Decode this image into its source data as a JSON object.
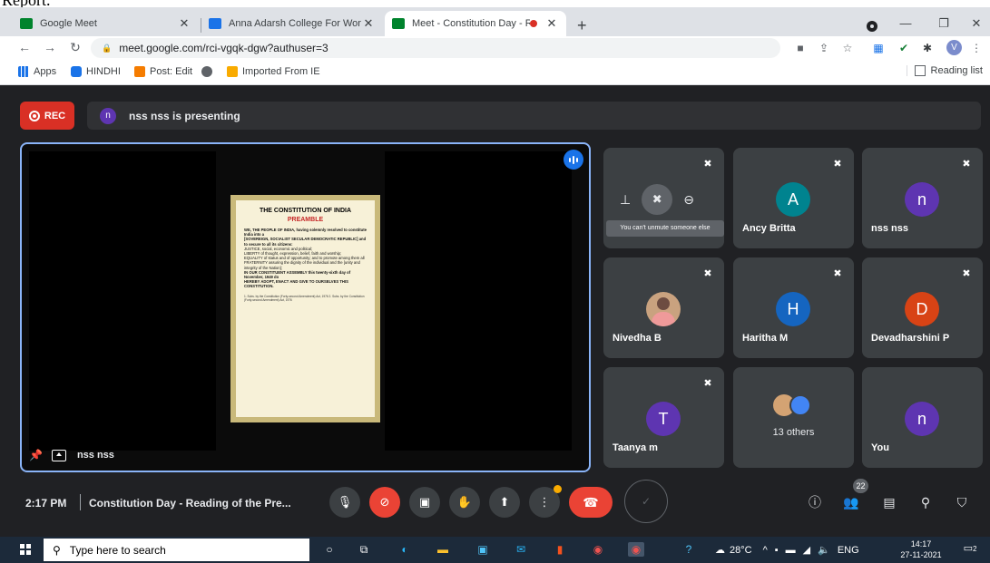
{
  "colors": {
    "accent": "#8ab4f8",
    "danger": "#ea4335",
    "tile_bg": "#3c4043",
    "meet_bg": "#202124"
  },
  "crop_text": "Report.",
  "browser": {
    "tabs": [
      {
        "label": "Google Meet",
        "icon": "google-meet-icon"
      },
      {
        "label": "Anna Adarsh College For Women",
        "icon": "calendar-icon"
      },
      {
        "label": "Meet - Constitution Day - Re",
        "icon": "google-meet-icon",
        "recording": true
      }
    ],
    "url": "meet.google.com/rci-vgqk-dgw?authuser=3",
    "profile_initial": "V",
    "bookmarks": [
      "Apps",
      "HINDHI",
      "Post: Edit",
      "Imported From IE"
    ],
    "reading_list": "Reading list"
  },
  "meet": {
    "rec_label": "REC",
    "presenting_initial": "n",
    "presenting_text": "nss nss is presenting",
    "presenter_tile_name": "nss nss",
    "document": {
      "title": "THE CONSTITUTION OF INDIA",
      "subtitle": "PREAMBLE",
      "lines": [
        "WE, THE PEOPLE OF INDIA, having solemnly resolved to constitute India into a",
        "[SOVEREIGN, SOCIALIST SECULAR DEMOCRATIC REPUBLIC] and to secure to all its citizens:",
        "JUSTICE, social, economic and political;",
        "LIBERTY of thought, expression, belief, faith and worship;",
        "EQUALITY of status and of opportunity; and to promote among them all",
        "FRATERNITY assuring the dignity of the individual and the [unity and integrity of the Nation];",
        "IN OUR CONSTITUENT ASSEMBLY this twenty-sixth day of November, 1949 do",
        "HEREBY ADOPT, ENACT AND GIVE TO OURSELVES THIS CONSTITUTION."
      ],
      "notes": "1. Subs. by the Constitution (Forty-second Amendment) Act, 1976 2. Subs. by the Constitution (Forty-second Amendment) Act, 1976"
    },
    "hover_tooltip": "You can't unmute someone else",
    "participants": [
      {
        "name": "Ancy Britta",
        "initial": "A",
        "color": "#00838f"
      },
      {
        "name": "nss nss",
        "initial": "n",
        "color": "#5e35b1"
      },
      {
        "name": "Nivedha B",
        "initial": "",
        "color": "#c9a27f"
      },
      {
        "name": "Haritha M",
        "initial": "H",
        "color": "#1565c0"
      },
      {
        "name": "Devadharshini P",
        "initial": "D",
        "color": "#d84315"
      },
      {
        "name": "Taanya m",
        "initial": "T",
        "color": "#5e35b1"
      },
      {
        "name": "You",
        "initial": "n",
        "color": "#5e35b1"
      }
    ],
    "others_label": "13 others",
    "others_initial": "",
    "time": "2:17 PM",
    "meeting_title": "Constitution Day - Reading of the Pre...",
    "people_count": "22"
  },
  "taskbar": {
    "search_placeholder": "Type here to search",
    "temperature": "28°C",
    "language": "ENG",
    "clock_time": "14:17",
    "clock_date": "27-11-2021",
    "notification_count": "2"
  }
}
